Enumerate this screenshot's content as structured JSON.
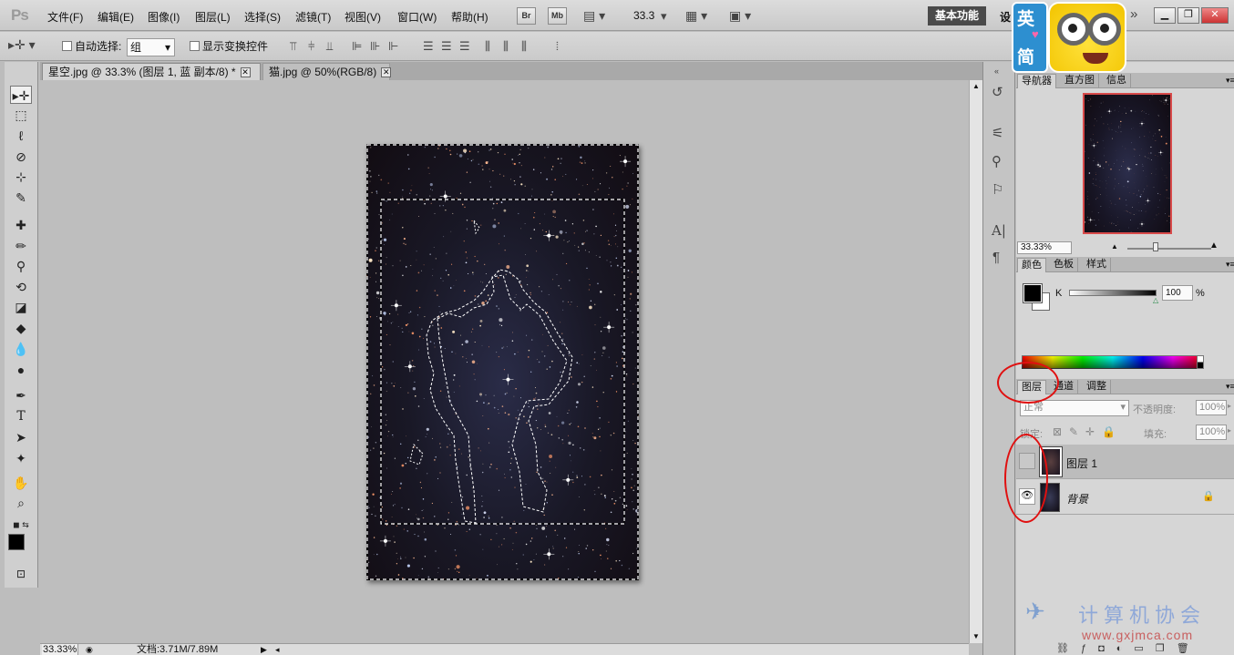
{
  "app": {
    "logo": "Ps"
  },
  "menu": [
    "文件(F)",
    "编辑(E)",
    "图像(I)",
    "图层(L)",
    "选择(S)",
    "滤镜(T)",
    "视图(V)",
    "窗口(W)",
    "帮助(H)"
  ],
  "appbar": {
    "br_label": "Br",
    "mb_label": "Mb",
    "zoom": "33.3",
    "workspace": "基本功能",
    "workspace_more": "设"
  },
  "options": {
    "auto_select_label": "自动选择:",
    "auto_select_value": "组",
    "show_transform_label": "显示变换控件"
  },
  "tabs": [
    {
      "title": "星空.jpg @ 33.3% (图层 1, 蓝 副本/8) *",
      "active": true
    },
    {
      "title": "猫.jpg @ 50%(RGB/8)",
      "active": false
    }
  ],
  "status": {
    "zoom": "33.33%",
    "doc": "文档:3.71M/7.89M"
  },
  "navigator": {
    "tabs": [
      "导航器",
      "直方图",
      "信息"
    ],
    "zoom": "33.33%"
  },
  "color": {
    "tabs": [
      "颜色",
      "色板",
      "样式"
    ],
    "channel": "K",
    "value": "100",
    "unit": "%"
  },
  "layers": {
    "tabs": [
      "图层",
      "通道",
      "调整"
    ],
    "blend_mode": "正常",
    "opacity_label": "不透明度:",
    "opacity": "100%",
    "lock_label": "锁定:",
    "fill_label": "填充:",
    "fill": "100%",
    "items": [
      {
        "name": "图层 1",
        "visible": false,
        "selected": true
      },
      {
        "name": "背景",
        "visible": true,
        "selected": false,
        "locked": true
      }
    ]
  },
  "badge": {
    "line1": "英",
    "line2": "简"
  },
  "watermark": {
    "title": "计算机协会",
    "url": "www.gxjmca.com"
  },
  "colors": {
    "accent_red": "#e01010",
    "workspace_bg": "#4a4a4a",
    "canvas_bg": "#bebebe"
  },
  "icons": [
    "move-icon",
    "marquee-icon",
    "lasso-icon",
    "quick-select-icon",
    "crop-icon",
    "eyedropper-icon",
    "healing-icon",
    "brush-icon",
    "stamp-icon",
    "history-brush-icon",
    "eraser-icon",
    "paint-bucket-icon",
    "blur-icon",
    "dodge-icon",
    "pen-icon",
    "type-icon",
    "path-select-icon",
    "shape-icon",
    "hand-icon",
    "zoom-icon",
    "eye-icon",
    "lock-icon"
  ]
}
